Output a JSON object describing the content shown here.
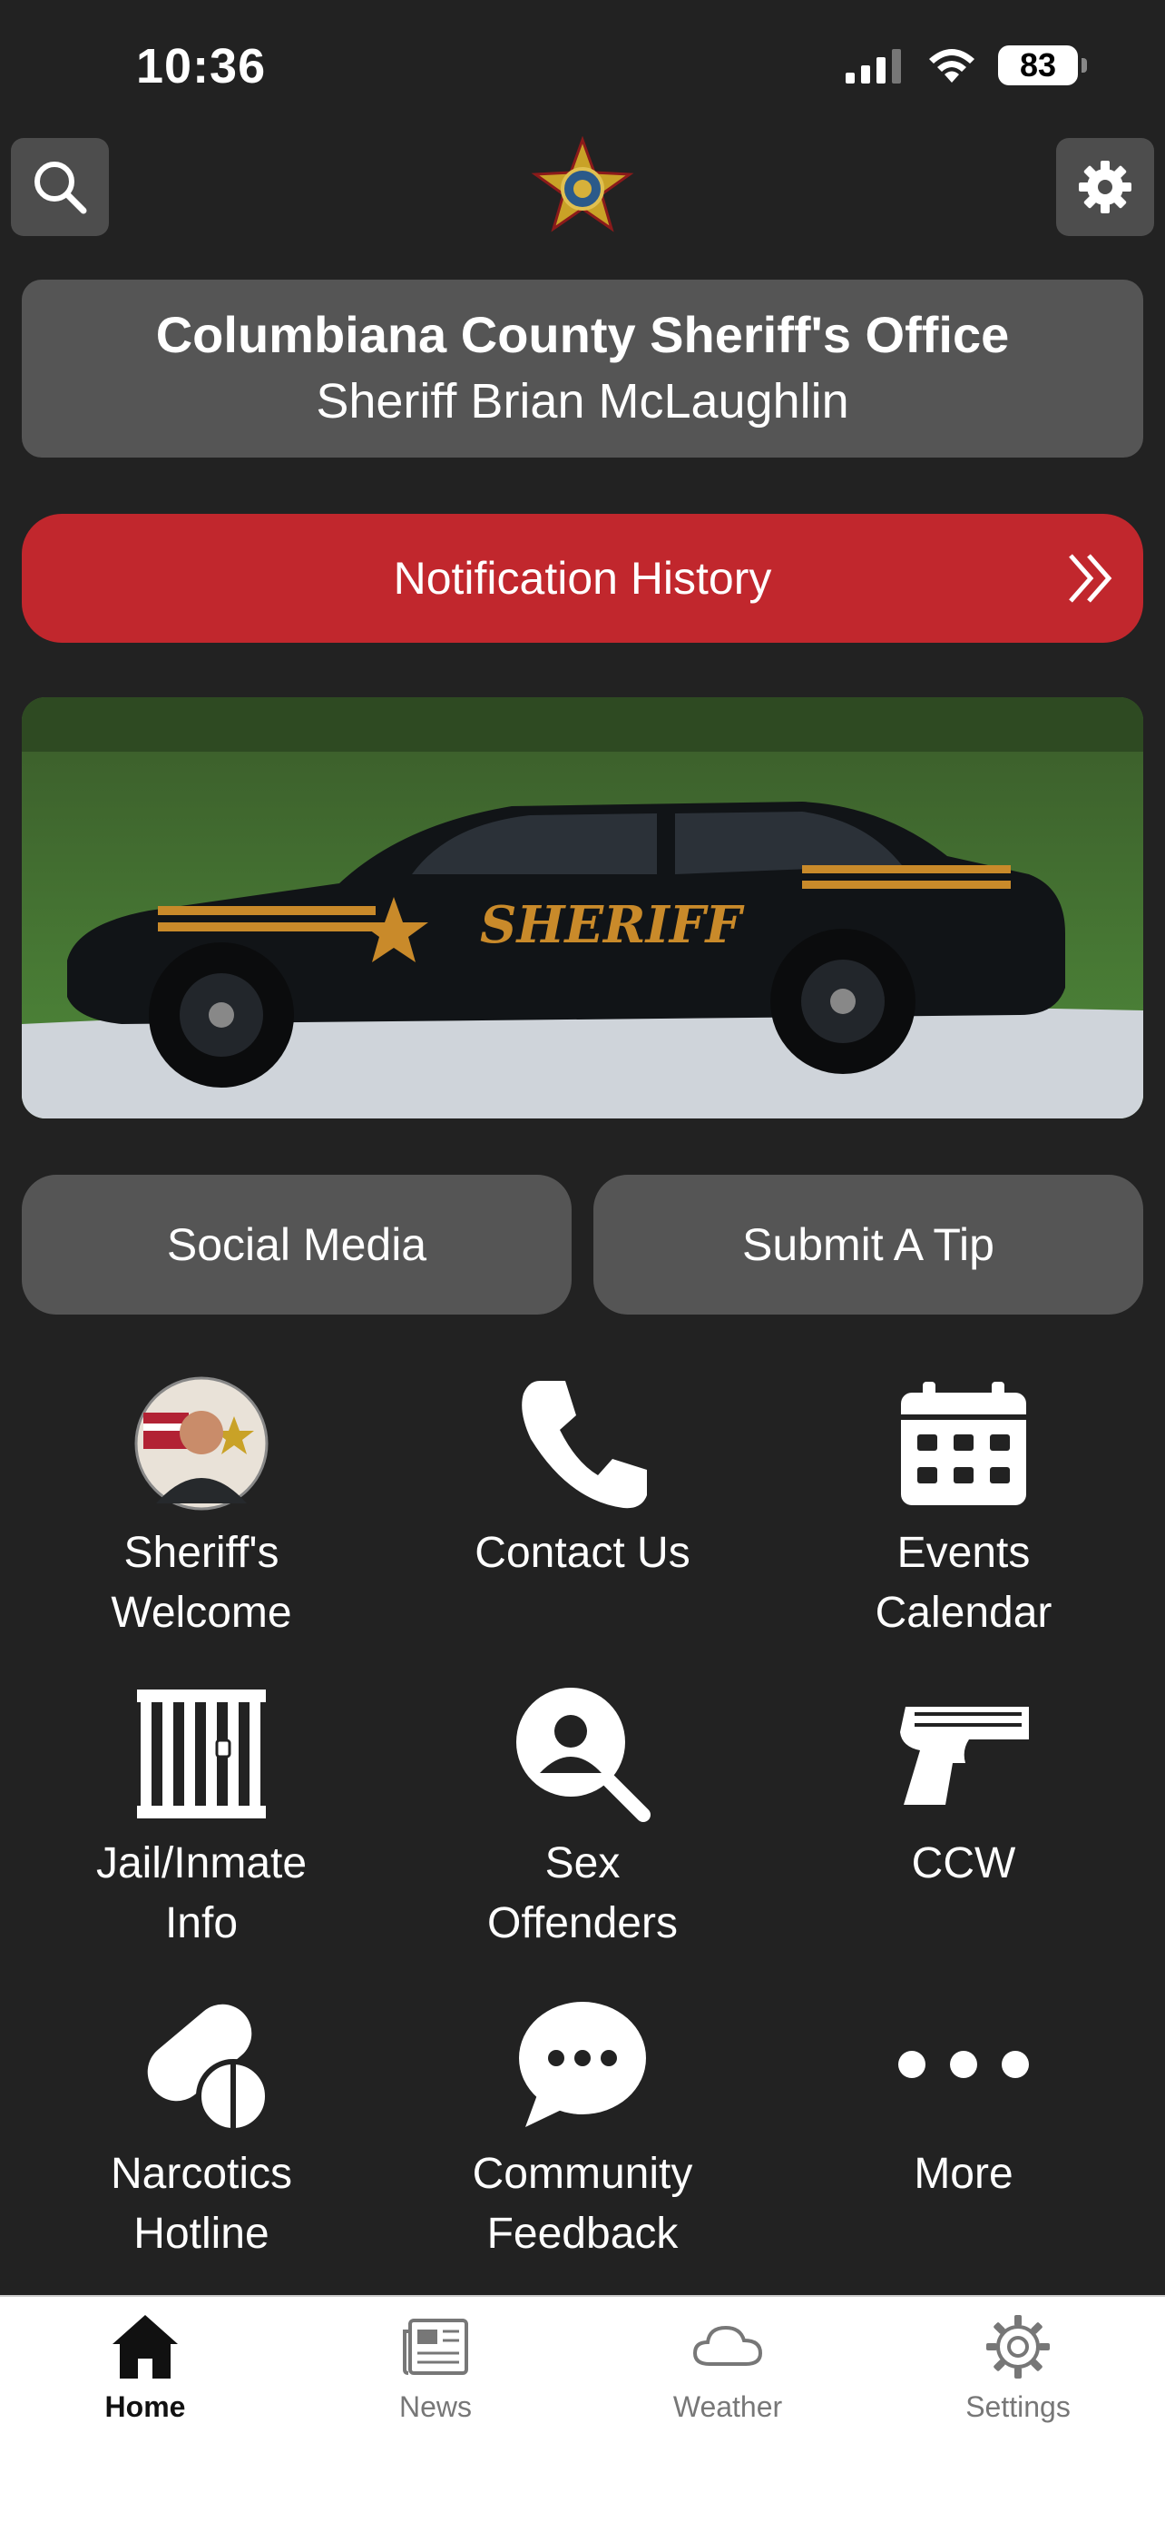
{
  "status": {
    "time": "10:36",
    "battery": "83"
  },
  "header": {
    "title": "Columbiana County Sheriff's Office",
    "subtitle": "Sheriff Brian McLaughlin"
  },
  "notification": {
    "label": "Notification History"
  },
  "hero": {
    "car_text": "SHERIFF"
  },
  "buttons": {
    "social": "Social Media",
    "tip": "Submit A Tip"
  },
  "grid": [
    {
      "label": "Sheriff's\nWelcome",
      "icon": "avatar"
    },
    {
      "label": "Contact Us",
      "icon": "phone-icon"
    },
    {
      "label": "Events\nCalendar",
      "icon": "calendar-icon"
    },
    {
      "label": "Jail/Inmate\nInfo",
      "icon": "jail-icon"
    },
    {
      "label": "Sex\nOffenders",
      "icon": "search-person-icon"
    },
    {
      "label": "CCW",
      "icon": "handgun-icon"
    },
    {
      "label": "Narcotics\nHotline",
      "icon": "pills-icon"
    },
    {
      "label": "Community\nFeedback",
      "icon": "chat-icon"
    },
    {
      "label": "More",
      "icon": "more-icon"
    }
  ],
  "tabs": [
    {
      "label": "Home",
      "icon": "home-icon"
    },
    {
      "label": "News",
      "icon": "news-icon"
    },
    {
      "label": "Weather",
      "icon": "cloud-icon"
    },
    {
      "label": "Settings",
      "icon": "gear-icon"
    }
  ],
  "colors": {
    "background": "#222222",
    "accent": "#c1272d",
    "card": "#555555"
  }
}
